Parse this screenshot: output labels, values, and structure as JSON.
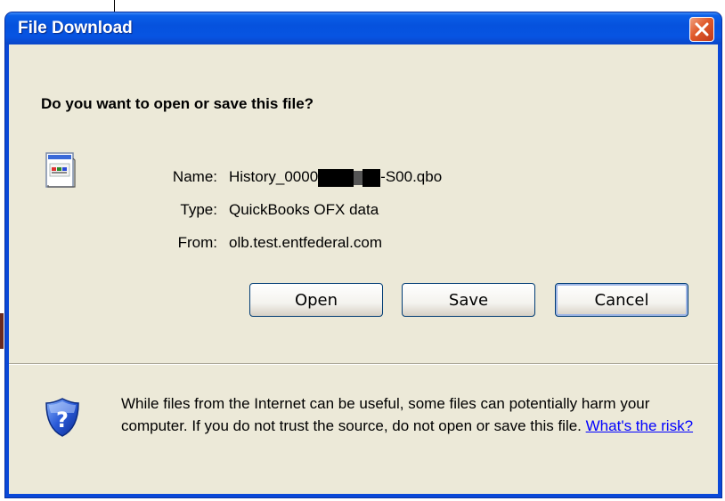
{
  "dialog": {
    "title": "File Download",
    "question": "Do you want to open or save this file?",
    "file": {
      "name_label": "Name:",
      "name_prefix": "History_0000",
      "name_suffix": "-S00.qbo",
      "type_label": "Type:",
      "type_value": "QuickBooks OFX data",
      "from_label": "From:",
      "from_value": "olb.test.entfederal.com"
    },
    "buttons": {
      "open": "Open",
      "save": "Save",
      "cancel": "Cancel"
    },
    "warning": {
      "text": "While files from the Internet can be useful, some files can potentially harm your computer. If you do not trust the source, do not open or save this file.",
      "link": "What's the risk?"
    }
  },
  "icons": {
    "file": "qbo-file-icon",
    "shield": "security-shield-question-icon",
    "close": "close-icon"
  },
  "colors": {
    "titlebar": "#0a5fe8",
    "client_bg": "#ece9d8",
    "close_button": "#e05a2a",
    "link": "#0000ff"
  }
}
